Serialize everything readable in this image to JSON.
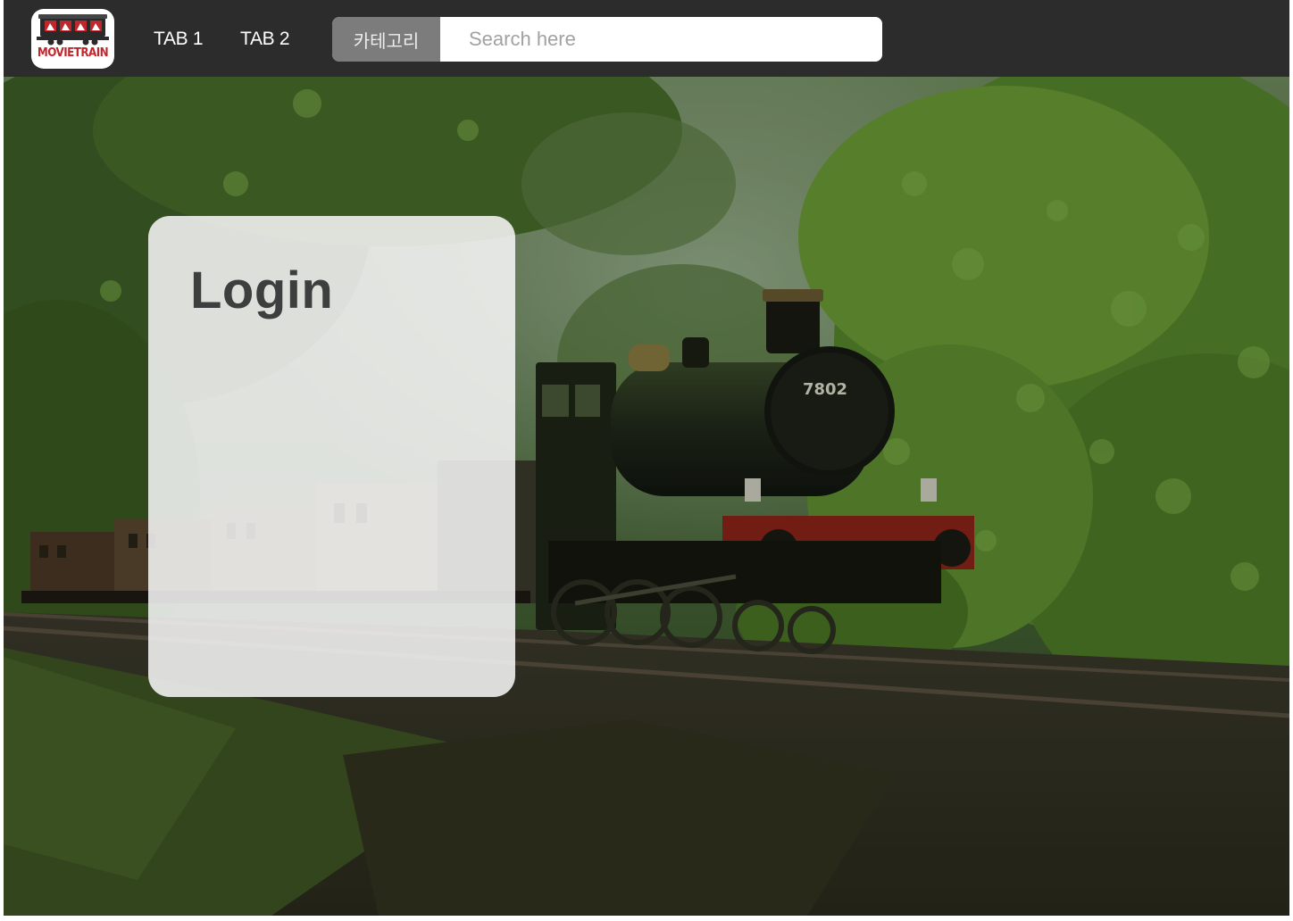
{
  "brand": {
    "logo_text": "MOVIETRAIN",
    "logo_accent": "#c0272d"
  },
  "nav": {
    "tabs": [
      {
        "label": "TAB 1"
      },
      {
        "label": "TAB 2"
      }
    ]
  },
  "search": {
    "category_label": "카테고리",
    "placeholder": "Search here",
    "value": ""
  },
  "hero": {
    "locomotive_number": "7802"
  },
  "login": {
    "title": "Login"
  },
  "colors": {
    "navbar_bg": "#2c2c2c",
    "category_bg": "#7c7c7c",
    "card_bg": "#f5f5f5",
    "title_text": "#3e3e3e",
    "foliage": "#4f7a2a"
  }
}
